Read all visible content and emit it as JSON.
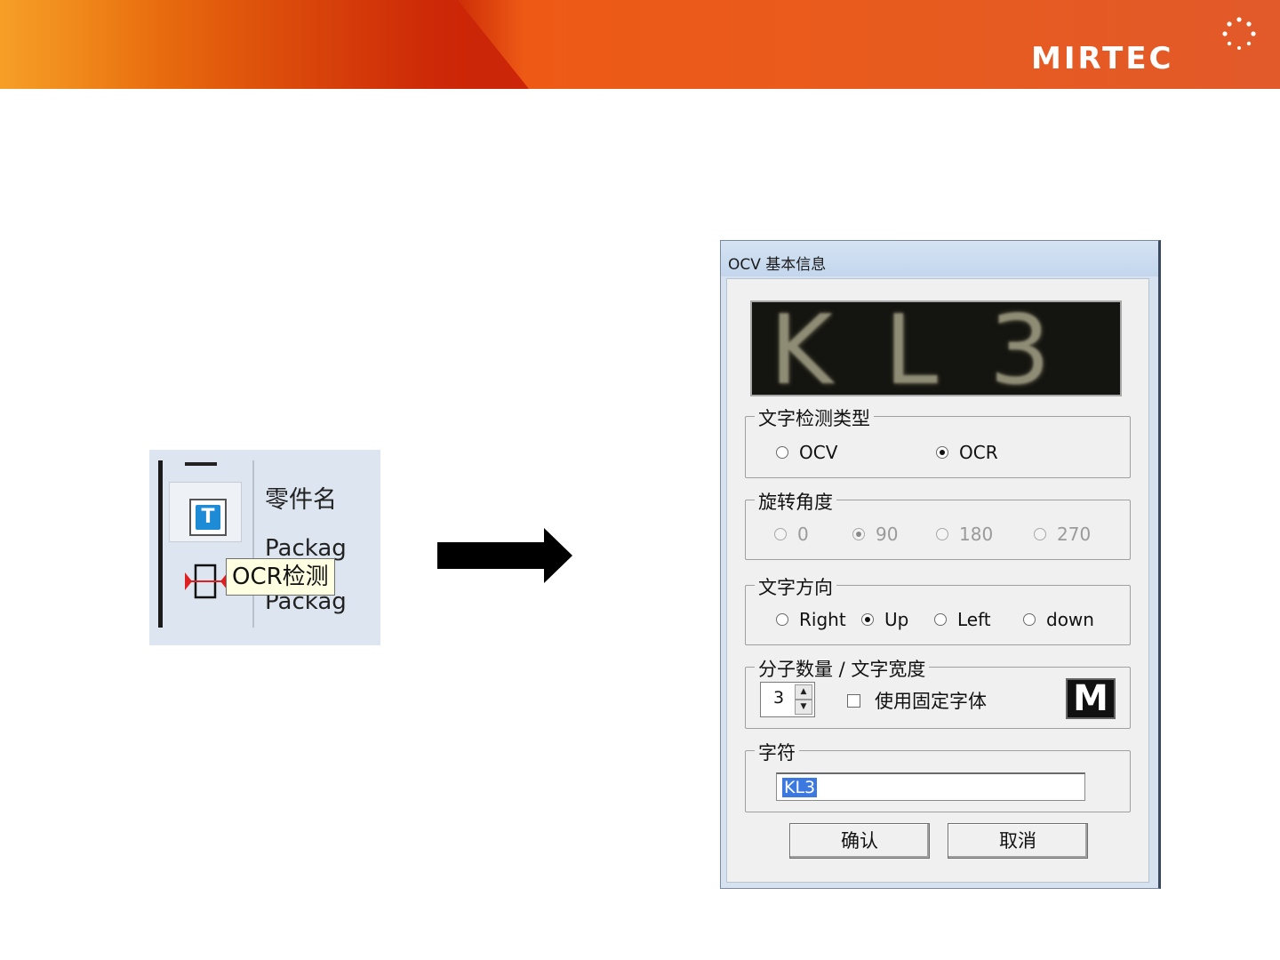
{
  "banner": {
    "logo_text": "MIRTEC"
  },
  "toolbar_crop": {
    "part_name_label": "零件名",
    "package_label_1": "Packag",
    "package_label_2": "Packag",
    "tooltip": "OCR检测",
    "t_icon_glyph": "T",
    "icons": [
      "t-tool-icon",
      "ocr-tool-icon"
    ]
  },
  "arrow": {
    "icon": "right-arrow-icon"
  },
  "dialog": {
    "title": "OCV 基本信息",
    "preview_text": "KL3",
    "detect_type": {
      "legend": "文字检测类型",
      "options": [
        "OCV",
        "OCR"
      ],
      "selected": "OCR"
    },
    "rotation": {
      "legend": "旋转角度",
      "options": [
        "0",
        "90",
        "180",
        "270"
      ],
      "selected": "90",
      "disabled": true
    },
    "direction": {
      "legend": "文字方向",
      "options": [
        "Right",
        "Up",
        "Left",
        "down"
      ],
      "selected": "Up"
    },
    "count_width": {
      "legend": "分子数量 / 文字宽度",
      "spin_value": "3",
      "fixed_font_label": "使用固定字体",
      "fixed_font_checked": false,
      "m_button_label": "M"
    },
    "characters": {
      "legend": "字符",
      "value": "KL3"
    },
    "buttons": {
      "ok": "确认",
      "cancel": "取消"
    }
  },
  "colors": {
    "banner_orange": "#e85b1e",
    "banner_red": "#cf3007",
    "selection_blue": "#3b78e0",
    "dialog_frame": "#d6e2ef"
  }
}
